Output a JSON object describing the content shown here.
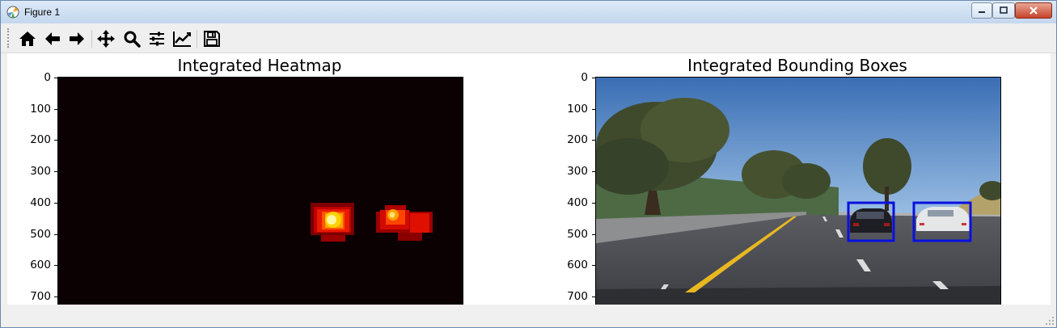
{
  "window": {
    "title": "Figure 1",
    "controls": [
      "minimize",
      "maximize",
      "close"
    ]
  },
  "toolbar": {
    "tools": [
      {
        "name": "home-icon",
        "tooltip": "Reset original view"
      },
      {
        "name": "back-icon",
        "tooltip": "Back to previous view"
      },
      {
        "name": "forward-icon",
        "tooltip": "Forward to next view"
      },
      {
        "name": "pan-icon",
        "tooltip": "Pan axes"
      },
      {
        "name": "zoom-icon",
        "tooltip": "Zoom to rectangle"
      },
      {
        "name": "subplots-icon",
        "tooltip": "Configure subplots"
      },
      {
        "name": "edit-axes-icon",
        "tooltip": "Edit axis, curve and image parameters"
      },
      {
        "name": "save-icon",
        "tooltip": "Save the figure"
      }
    ]
  },
  "plots": {
    "left": {
      "title": "Integrated Heatmap",
      "yticks": [
        "0",
        "100",
        "200",
        "300",
        "400",
        "500",
        "600",
        "700"
      ]
    },
    "right": {
      "title": "Integrated Bounding Boxes",
      "yticks": [
        "0",
        "100",
        "200",
        "300",
        "400",
        "500",
        "600",
        "700"
      ]
    }
  },
  "colors": {
    "heatmap_background": "#0b0002",
    "bounding_box": "#0a10e0",
    "hot": [
      "#7a0000",
      "#c00000",
      "#ff3300",
      "#ff8800",
      "#ffd000",
      "#fffac0"
    ]
  }
}
